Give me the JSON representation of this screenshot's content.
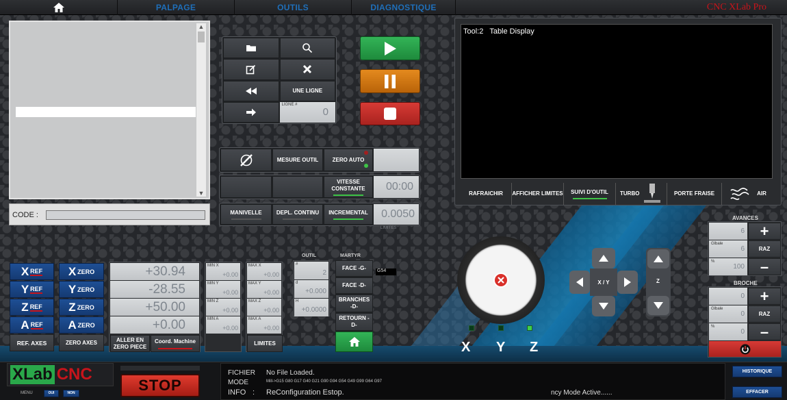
{
  "nav": {
    "tabs": [
      "PALPAGE",
      "OUTILS",
      "DIAGNOSTIQUE"
    ],
    "brand": "CNC XLab Pro"
  },
  "code": {
    "label": "CODE :"
  },
  "file_buttons": {
    "line_label": "UNE LIGNE",
    "line_num_label": "LIGNE #",
    "line_num_value": "0"
  },
  "tool": {
    "measure": "MESURE OUTIL",
    "zero_auto": "ZERO AUTO",
    "vitesse": "VITESSE CONSTANTE",
    "time": "00:00",
    "manivelle": "MANIVELLE",
    "depl_continu": "DEPL. CONTINU",
    "incremental": "INCREMENTAL",
    "incremental_value": "0.0050",
    "limites_small": "LIMITES"
  },
  "display": {
    "title": "Tool:2   Table Display",
    "rafraichir": "RAFRAICHIR",
    "afficher": "AFFICHER LIMITES",
    "suivi": "SUIVI D'OUTIL",
    "turbo": "TURBO",
    "porte_fraise": "PORTE FRAISE",
    "air": "AIR"
  },
  "avances": {
    "title": "AVANCES",
    "val1": "6",
    "label2": "Glbale",
    "val2": "6",
    "label3": "%",
    "val3": "100",
    "raz": "RAZ"
  },
  "broche": {
    "title": "BROCHE",
    "val1": "0",
    "label2": "Glbale",
    "val2": "0",
    "label3": "%",
    "val3": "0",
    "raz": "RAZ"
  },
  "axes": {
    "refs": [
      {
        "l": "X",
        "s": "REF"
      },
      {
        "l": "Y",
        "s": "REF"
      },
      {
        "l": "Z",
        "s": "REF"
      },
      {
        "l": "A",
        "s": "REF"
      }
    ],
    "zeros": [
      {
        "l": "X",
        "s": "ZERO"
      },
      {
        "l": "Y",
        "s": "ZERO"
      },
      {
        "l": "Z",
        "s": "ZERO"
      },
      {
        "l": "A",
        "s": "ZERO"
      }
    ],
    "ref_axes": "REF. AXES",
    "zero_axes": "ZERO AXES",
    "dro": [
      "+30.94",
      "-28.55",
      "+50.00",
      "+0.00"
    ],
    "aller": "ALLER EN ZERO PIECE",
    "coord": "Coord. Machine",
    "min_labels": [
      "MIN X",
      "MIN Y",
      "MIN Z",
      "MIN A"
    ],
    "min_vals": [
      "+0.00",
      "+0.00",
      "+0.00",
      "+0.00"
    ],
    "max_labels": [
      "MAX X",
      "MAX Y",
      "MAX Z",
      "MAX A"
    ],
    "max_vals": [
      "+0.00",
      "+0.00",
      "+0.00",
      "+0.00"
    ],
    "limites": "LIMITES"
  },
  "outil": {
    "title": "OUTIL",
    "labels": [
      "#",
      "d",
      "H"
    ],
    "vals": [
      "2",
      "+0.000",
      "+0.0000"
    ]
  },
  "martyr": {
    "title": "MARTYR",
    "face_g": "FACE -G-",
    "face_d": "FACE -D-",
    "branches": "BRANCHES -D-",
    "retour": "RETOURN -D-",
    "g54": "G54"
  },
  "jog": {
    "xy": "X / Y",
    "z": "Z",
    "axis_labels": [
      "X",
      "Y",
      "Z"
    ]
  },
  "bottom": {
    "logo1": "XLab",
    "logo2": "CNC",
    "menu": "MENU",
    "oui": "OUI",
    "non": "NON",
    "stop": "STOP",
    "fichier_label": "FICHIER",
    "fichier_val": "No File Loaded.",
    "mode_label": "MODE",
    "mode_val": "Mill->G15  G80 G17 G40 G21 G90 G94 G54 G49 G99 G64 G97",
    "info_label": "INFO",
    "info_sep": ":",
    "info_val": "ReConfiguration Estop.",
    "status": "ncy Mode Active......",
    "historique": "HISTORIQUE",
    "effacer": "EFFACER"
  },
  "colors": {
    "accent_blue": "#1f6fb9",
    "brand_red": "#c8141b",
    "green": "#2aa84a",
    "orange": "#d77a12",
    "red": "#c9302c"
  }
}
